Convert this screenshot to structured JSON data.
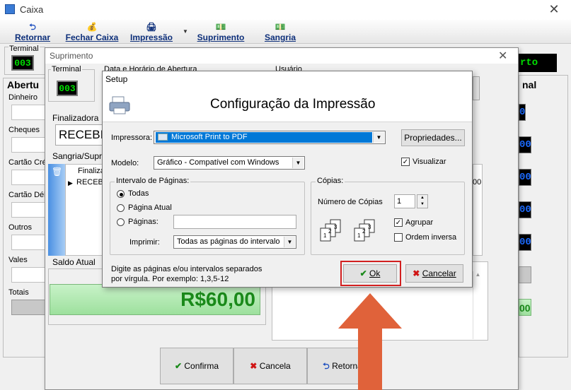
{
  "main_window": {
    "title": "Caixa",
    "close": "✕",
    "toolbar": [
      {
        "label": "Retornar",
        "icon": "⮌"
      },
      {
        "label": "Fechar Caixa",
        "icon": "💰"
      },
      {
        "label": "Impressão",
        "icon": "🖨"
      },
      {
        "label": "Suprimento",
        "icon": "💵"
      },
      {
        "label": "Sangria",
        "icon": "💵"
      }
    ],
    "dropdown_caret": "▼",
    "terminal_label": "Terminal",
    "terminal_value": "003",
    "status_value": "rto",
    "left_header": "Abertu",
    "right_header": "nal",
    "left_rows": [
      "Dinheiro",
      "Cheques",
      "Cartão Cré",
      "Cartão Déb",
      "Outros",
      "Vales",
      "Totais"
    ],
    "right_values": [
      "0",
      "00",
      "00",
      "00",
      "00",
      "",
      "00"
    ]
  },
  "suprimento": {
    "title": "Suprimento",
    "close": "✕",
    "terminal_label": "Terminal",
    "terminal_value": "003",
    "date_label": "Data e Horário de Abertura",
    "user_label": "Usuário",
    "finalizadora_label": "Finalizadora",
    "finalizadora_value": "RECEBI",
    "sangria_label": "Sangria/Suprir",
    "grid_header": "Finaliza",
    "grid_row": "RECEB",
    "grid_right_value": "00",
    "saldo_label": "Saldo Atual",
    "saldo_value": "R$60,00",
    "buttons": [
      {
        "label": "Confirma",
        "icon": "✔",
        "color": "#1a8a1a"
      },
      {
        "label": "Cancela",
        "icon": "✖",
        "color": "#d01515"
      },
      {
        "label": "Retornar",
        "icon": "⮌",
        "color": "#1e4fbf"
      }
    ]
  },
  "setup": {
    "title": "Setup",
    "heading": "Configuração da Impressão",
    "impressora_label": "Impressora:",
    "impressora_value": "Microsoft Print to PDF",
    "propriedades": "Propriedades...",
    "modelo_label": "Modelo:",
    "modelo_value": "Gráfico - Compatível com Windows",
    "visualizar": "Visualizar",
    "visualizar_checked": true,
    "intervalo_legend": "Intervalo de Páginas:",
    "radio_todas": "Todas",
    "radio_atual": "Página Atual",
    "radio_paginas": "Páginas:",
    "imprimir_label": "Imprimir:",
    "imprimir_value": "Todas as páginas do intervalo",
    "copias_legend": "Cópias:",
    "num_copias_label": "Número de Cópias",
    "num_copias_value": "1",
    "agrupar": "Agrupar",
    "agrupar_checked": true,
    "ordem_inversa": "Ordem inversa",
    "ordem_inversa_checked": false,
    "hint_line1": "Digite as páginas e/ou intervalos separados",
    "hint_line2": "por vírgula.  Por exemplo: 1,3,5-12",
    "ok": "Ok",
    "cancelar": "Cancelar",
    "page_numbers": [
      "1",
      "2",
      "3"
    ],
    "colors": {
      "selection": "#0078d7",
      "highlight": "#d21f1f",
      "arrow": "#e0623a"
    }
  }
}
